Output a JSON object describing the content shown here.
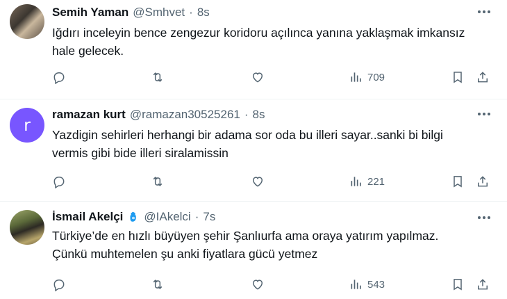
{
  "tweets": [
    {
      "name": "Semih Yaman",
      "handle": "@Smhvet",
      "dot": "·",
      "time": "8s",
      "avatar": "photo",
      "text_lines": [
        "Iğdırı inceleyin bence zengezur koridoru açılınca yanına yaklaşmak imkansız",
        "hale gelecek."
      ],
      "views": "709"
    },
    {
      "name": "ramazan kurt",
      "handle": "@ramazan30525261",
      "dot": "·",
      "time": "8s",
      "avatar_letter": "r",
      "avatar_color": "#7856ff",
      "text_lines": [
        "Yazdigin sehirleri herhangi bir adama sor oda bu illeri sayar..sanki bi bilgi",
        "vermis gibi bide illeri siralamissin"
      ],
      "views": "221"
    },
    {
      "name": "İsmail Akelçi",
      "handle": "@IAkelci",
      "dot": "·",
      "time": "7s",
      "badge_icon": "hamsa-icon",
      "avatar": "photo",
      "text_lines": [
        "Türkiye’de en hızlı büyüyen şehir Şanlıurfa ama oraya yatırım yapılmaz.",
        "Çünkü muhtemelen şu anki fiyatlara gücü yetmez"
      ],
      "views": "543"
    }
  ],
  "colors": {
    "text": "#0f1419",
    "secondary": "#536471",
    "divider": "#eff3f4",
    "badge": "#1d9bf0"
  }
}
